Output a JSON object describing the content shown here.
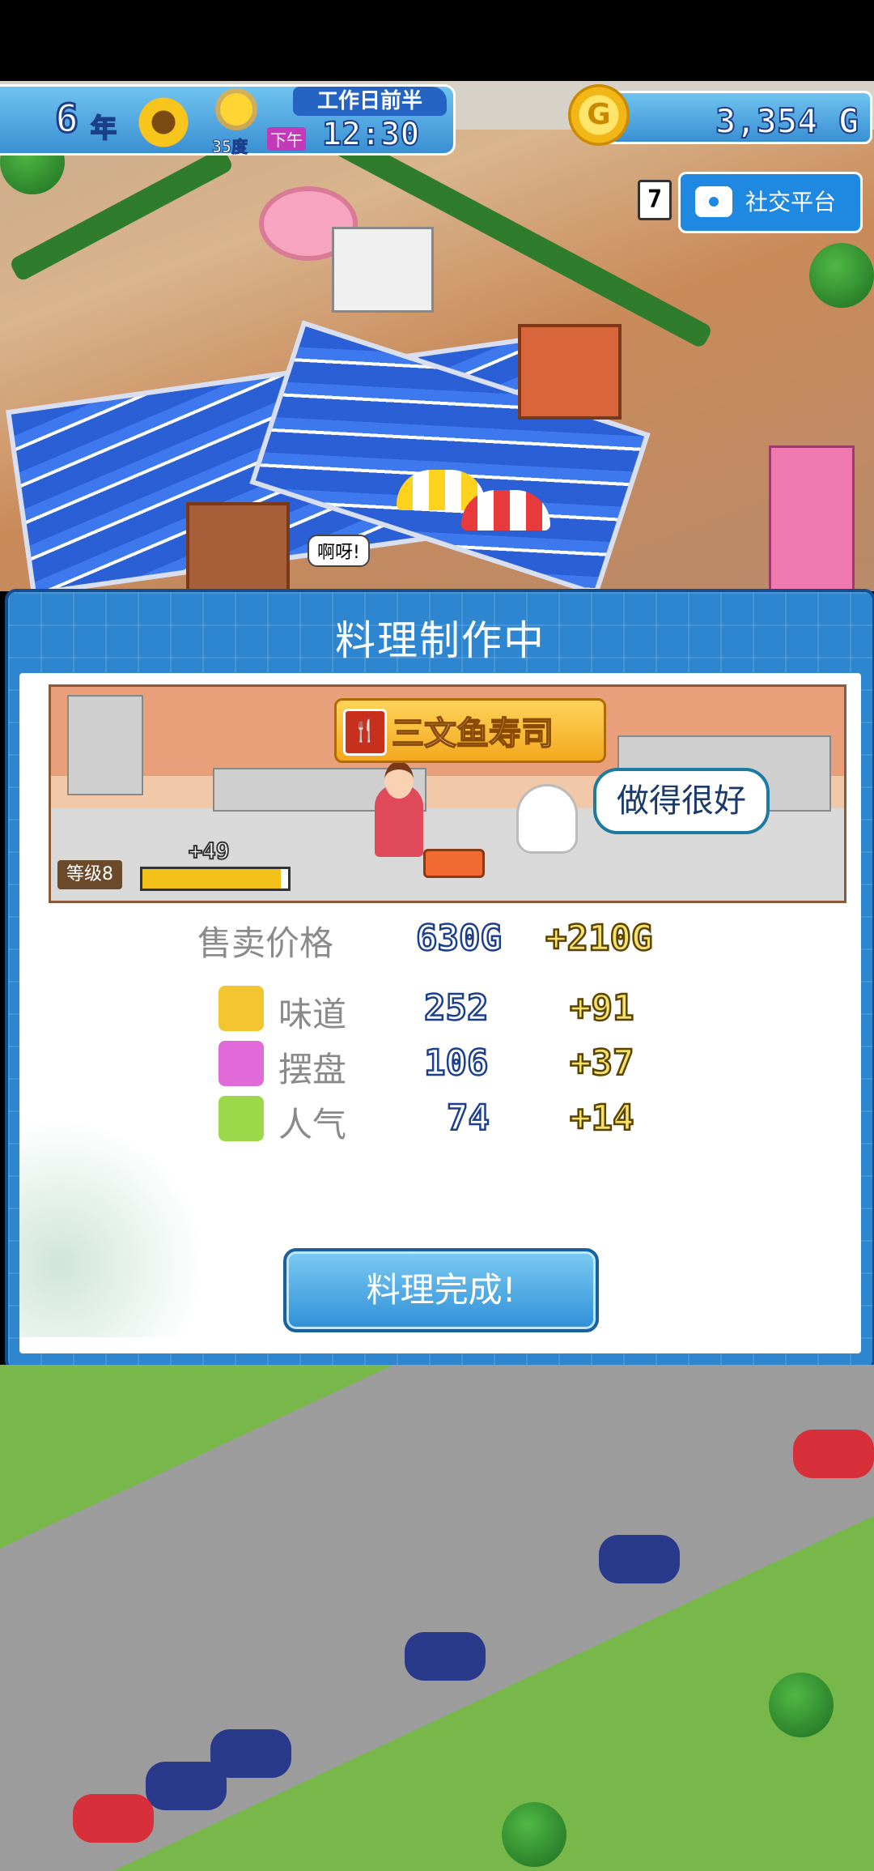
{
  "hud": {
    "year_number": "6",
    "year_label": "年",
    "temperature": "35度",
    "period": "工作日前半",
    "ampm": "下午",
    "time": "12:30",
    "money": "3,354 G",
    "coin_symbol": "G"
  },
  "social": {
    "count": "7",
    "label": "社交平台"
  },
  "scene_speech": "啊呀!",
  "dialog": {
    "title": "料理制作中",
    "dish_name": "三文鱼寿司",
    "comment": "做得很好",
    "level_label": "等级8",
    "exp_gain": "+49",
    "exp_progress": 0.95,
    "price_label": "售卖价格",
    "price_value": "630G",
    "price_bonus": "+210G",
    "stats": [
      {
        "icon": "taste-icon",
        "label": "味道",
        "value": "252",
        "bonus": "+91",
        "color": "#f5c431"
      },
      {
        "icon": "presentation-icon",
        "label": "摆盘",
        "value": "106",
        "bonus": "+37",
        "color": "#e06ad8"
      },
      {
        "icon": "popularity-icon",
        "label": "人气",
        "value": "74",
        "bonus": "+14",
        "color": "#9bd84a"
      }
    ],
    "done_button": "料理完成!"
  }
}
